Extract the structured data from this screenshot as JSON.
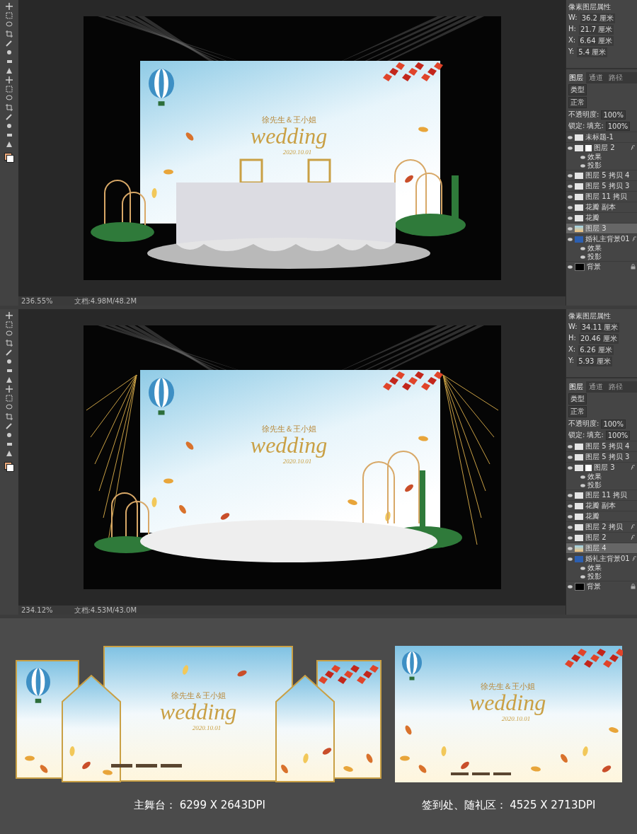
{
  "windows": [
    {
      "properties": {
        "title": "像素图层属性",
        "fields": [
          {
            "label": "W:",
            "value": "36.2 厘米"
          },
          {
            "label": "H:",
            "value": "21.7 厘米"
          },
          {
            "label": "X:",
            "value": "6.64 厘米"
          },
          {
            "label": "Y:",
            "value": "5.4 厘米"
          }
        ]
      },
      "layers_panel": {
        "tabs": [
          {
            "label": "图层",
            "selected": true
          },
          {
            "label": "通道",
            "selected": false
          },
          {
            "label": "路径",
            "selected": false
          }
        ],
        "filter": "类型",
        "blend_mode": "正常",
        "opacity_label": "不透明度:",
        "opacity": "100%",
        "lock_label": "锁定:",
        "fill_label": "填充:",
        "fill": "100%",
        "layers": [
          {
            "name": "未标题-1",
            "kind": "blank",
            "selected": false
          },
          {
            "name": "图层 2",
            "kind": "blank",
            "selected": false,
            "mask": true,
            "fx": true,
            "children": [
              {
                "name": "效果"
              },
              {
                "name": "投影"
              }
            ]
          },
          {
            "name": "图层 5 拷贝 4",
            "kind": "blank",
            "selected": false
          },
          {
            "name": "图层 5 拷贝 3",
            "kind": "blank",
            "selected": false
          },
          {
            "name": "图层 11 拷贝",
            "kind": "blank",
            "selected": false
          },
          {
            "name": "花瓣 副本",
            "kind": "blank",
            "selected": false
          },
          {
            "name": "花瓣",
            "kind": "blank",
            "selected": false
          },
          {
            "name": "图层 3",
            "kind": "image",
            "selected": true
          },
          {
            "name": "婚礼主背景01",
            "kind": "blue",
            "selected": false,
            "fx": true,
            "children": [
              {
                "name": "效果"
              },
              {
                "name": "投影"
              }
            ]
          },
          {
            "name": "背景",
            "kind": "black",
            "selected": false,
            "locked": true
          }
        ]
      },
      "scene": {
        "kind": "head-table",
        "couple": "徐先生＆王小姐",
        "title": "wedding",
        "date": "2020.10.01"
      },
      "status": {
        "zoom": "236.55%",
        "document": "文档:4.98M/48.2M"
      }
    },
    {
      "properties": {
        "title": "像素图层属性",
        "fields": [
          {
            "label": "W:",
            "value": "34.11 厘米"
          },
          {
            "label": "H:",
            "value": "20.46 厘米"
          },
          {
            "label": "X:",
            "value": "6.26 厘米"
          },
          {
            "label": "Y:",
            "value": "5.93 厘米"
          }
        ]
      },
      "layers_panel": {
        "tabs": [
          {
            "label": "图层",
            "selected": true
          },
          {
            "label": "通道",
            "selected": false
          },
          {
            "label": "路径",
            "selected": false
          }
        ],
        "filter": "类型",
        "blend_mode": "正常",
        "opacity_label": "不透明度:",
        "opacity": "100%",
        "lock_label": "锁定:",
        "fill_label": "填充:",
        "fill": "100%",
        "layers": [
          {
            "name": "图层 5 拷贝 4",
            "kind": "blank",
            "selected": false
          },
          {
            "name": "图层 5 拷贝 3",
            "kind": "blank",
            "selected": false
          },
          {
            "name": "图层 3",
            "kind": "blank",
            "selected": false,
            "mask": true,
            "fx": true,
            "children": [
              {
                "name": "效果"
              },
              {
                "name": "投影"
              }
            ]
          },
          {
            "name": "图层 11 拷贝",
            "kind": "blank",
            "selected": false
          },
          {
            "name": "花瓣 副本",
            "kind": "blank",
            "selected": false
          },
          {
            "name": "花瓣",
            "kind": "blank",
            "selected": false
          },
          {
            "name": "图层 2 拷贝",
            "kind": "blank",
            "selected": false,
            "fx": true
          },
          {
            "name": "图层 2",
            "kind": "blank",
            "selected": false,
            "fx": true
          },
          {
            "name": "图层 4",
            "kind": "image",
            "selected": true
          },
          {
            "name": "婚礼主背景01",
            "kind": "blue",
            "selected": false,
            "fx": true,
            "children": [
              {
                "name": "效果"
              },
              {
                "name": "投影"
              }
            ]
          },
          {
            "name": "背景",
            "kind": "black",
            "selected": false,
            "locked": true
          }
        ]
      },
      "scene": {
        "kind": "cloud-stage",
        "couple": "徐先生＆王小姐",
        "title": "wedding",
        "date": "2020.10.01"
      },
      "status": {
        "zoom": "234.12%",
        "document": "文档:4.53M/43.0M"
      }
    }
  ],
  "designs": [
    {
      "kind": "main-stage",
      "couple": "徐先生＆王小姐",
      "title": "wedding",
      "date": "2020.10.01",
      "caption": "主舞台： 6299 X 2643DPI"
    },
    {
      "kind": "sign-in",
      "couple": "徐先生＆王小姐",
      "title": "wedding",
      "date": "2020.10.01",
      "caption": "签到处、随礼区： 4525 X 2713DPI"
    }
  ]
}
